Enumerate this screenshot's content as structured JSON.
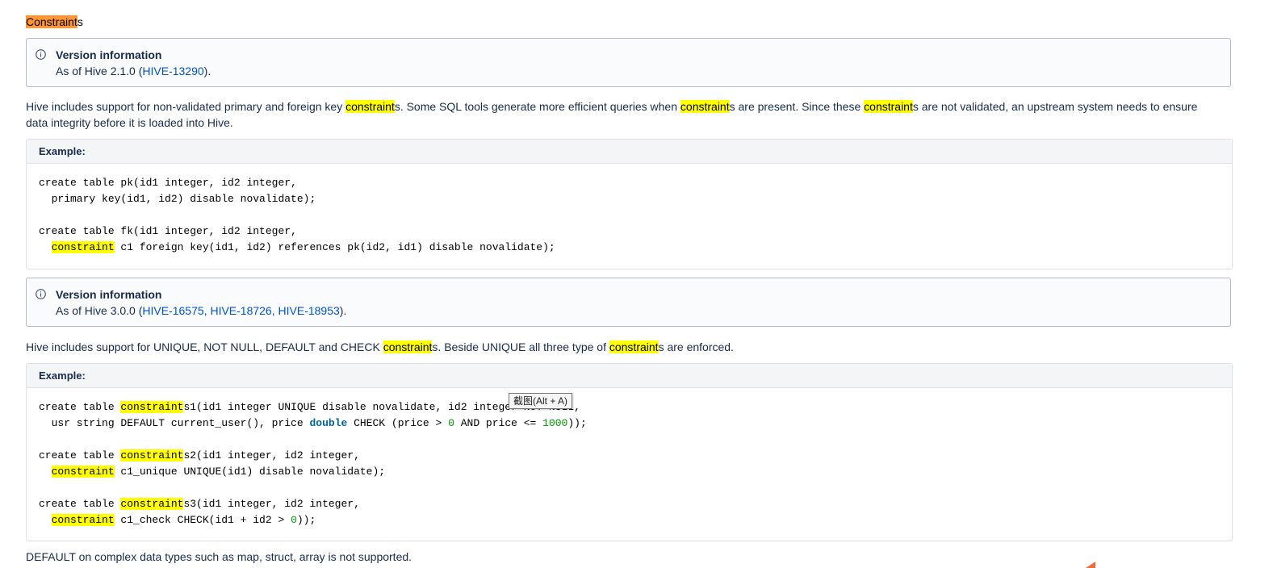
{
  "heading": {
    "match": "Constraint",
    "rest": "s"
  },
  "info1": {
    "title": "Version information",
    "prefix": "As of Hive 2.1.0 (",
    "links": [
      "HIVE-13290"
    ],
    "suffix": ")."
  },
  "para1": {
    "t1": "Hive includes support for non-validated primary and foreign key ",
    "h1": "constraint",
    "t2": "s. Some SQL tools generate more efficient queries when ",
    "h2": "constraint",
    "t3": "s are present. Since these ",
    "h3": "constraint",
    "t4": "s are not validated, an upstream system needs to ensure data integrity before it is loaded into Hive."
  },
  "example1": {
    "header": "Example:",
    "l1": "create table pk(id1 integer, id2 integer,",
    "l2": "  primary key(id1, id2) disable novalidate);",
    "l3": "create table fk(id1 integer, id2 integer,",
    "l4_pre": "  ",
    "l4_hl": "constraint",
    "l4_post": " c1 foreign key(id1, id2) references pk(id2, id1) disable novalidate);"
  },
  "info2": {
    "title": "Version information",
    "prefix": "As of Hive 3.0.0 (",
    "links": [
      "HIVE-16575",
      "HIVE-18726",
      "HIVE-18953"
    ],
    "sep": ", ",
    "suffix": ")."
  },
  "para2": {
    "t1": "Hive includes support for UNIQUE, NOT NULL, DEFAULT and CHECK ",
    "h1": "constraint",
    "t2": "s. Beside UNIQUE all three type of ",
    "h2": "constraint",
    "t3": "s are enforced."
  },
  "example2": {
    "header": "Example:",
    "a1": "create table ",
    "a_hl": "constraint",
    "a2": "s1(id1 integer UNIQUE disable novalidate, id2 integer NOT NULL,",
    "b1": "  usr string DEFAULT current_user(), price ",
    "b_kw": "double",
    "b2": " CHECK (price > ",
    "b_n1": "0",
    "b3": " AND price <= ",
    "b_n2": "1000",
    "b4": "));",
    "c1": "create table ",
    "c_hl": "constraint",
    "c2": "s2(id1 integer, id2 integer,",
    "d1": "  ",
    "d_hl": "constraint",
    "d2": " c1_unique UNIQUE(id1) disable novalidate);",
    "e1": "create table ",
    "e_hl": "constraint",
    "e2": "s3(id1 integer, id2 integer,",
    "f1": "  ",
    "f_hl": "constraint",
    "f2": " c1_check CHECK(id1 + id2 > ",
    "f_n": "0",
    "f3": "));"
  },
  "tooltip": "截图(Alt + A)",
  "footer": "DEFAULT on complex data types such as map, struct, array is not supported.",
  "colors": {
    "highlight": "#ffff00",
    "current_match": "#ff9632",
    "link": "#0052cc"
  }
}
